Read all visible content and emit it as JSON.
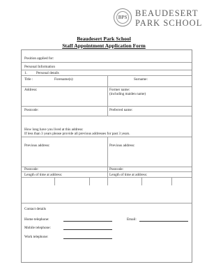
{
  "logo": {
    "crest_mark": "BPS",
    "line1": "BEAUDESERT",
    "line2": "PARK SCHOOL"
  },
  "header": {
    "school_name": "Beaudesert Park School",
    "form_title": "Staff Appointment Application Form"
  },
  "form": {
    "position_applied": "Position applied for:",
    "personal_information": "Personal Information",
    "section1_number": "1.",
    "section1_title": "Personal details",
    "title_label": "Title :",
    "forenames_label": "Forename(s):",
    "surname_label": "Surname:",
    "address_label": "Address:",
    "former_name_label": "Former name:",
    "former_name_note": "(including maiden name)",
    "postcode_label": "Postcode:",
    "preferred_name_label": "Preferred name:",
    "how_long_label": "How long have you lived at this address:",
    "if_less_label": "If less than 3 years please provide all previous addresses for past 3 years.",
    "prev_address_left": "Previous address:",
    "prev_address_right": "Previous address:",
    "postcode_left": "Postcode:",
    "postcode_right": "Postcode:",
    "length_left": "Length of time at address:",
    "length_right": "Length of time at address:",
    "contact_details": "Contact details",
    "home_tel_label": "Home telephone:",
    "email_label": "Email:",
    "mobile_label": "Mobile telephone:",
    "work_label": "Work telephone:"
  }
}
